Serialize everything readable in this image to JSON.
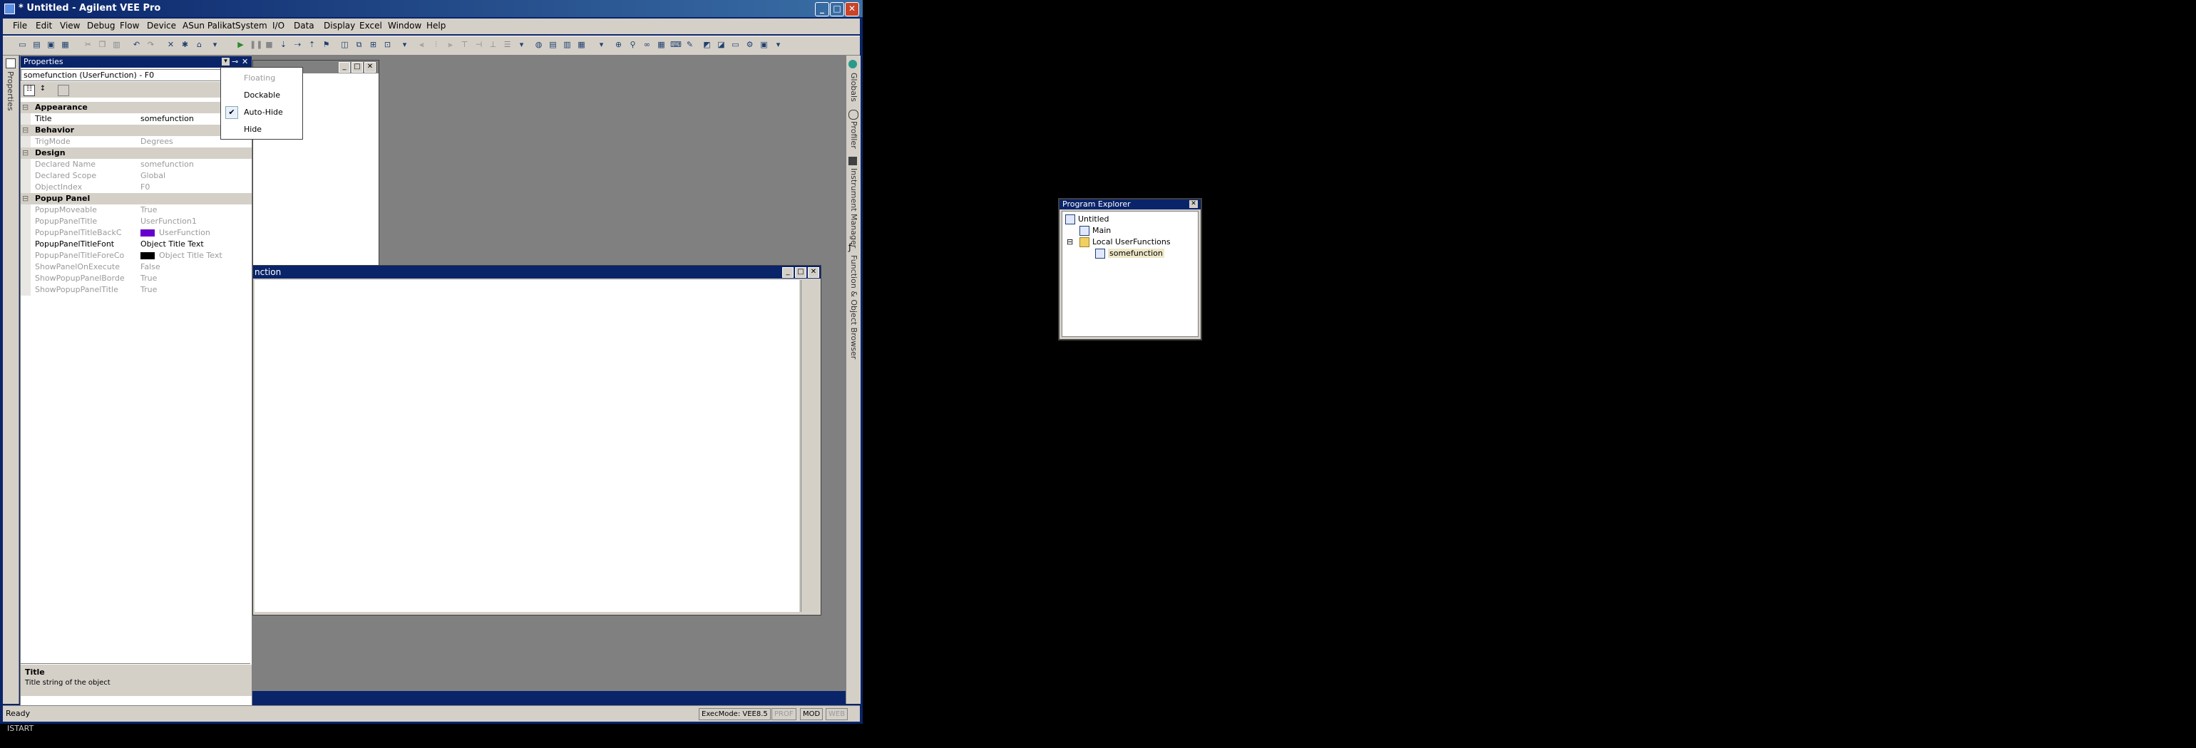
{
  "window": {
    "title": "* Untitled - Agilent VEE Pro",
    "min_glyph": "_",
    "max_glyph": "□",
    "close_glyph": "✕"
  },
  "menu": [
    "File",
    "Edit",
    "View",
    "Debug",
    "Flow",
    "Device",
    "ASun Palikat",
    "System",
    "I/O",
    "Data",
    "Display",
    "Excel",
    "Window",
    "Help"
  ],
  "left_dock": {
    "tab_label": "Properties"
  },
  "properties": {
    "panel_title": "Properties",
    "object_name": "somefunction (UserFunction) - F0",
    "categories": [
      {
        "name": "Appearance",
        "rows": [
          {
            "label": "Title",
            "value": "somefunction",
            "dim": false
          }
        ]
      },
      {
        "name": "Behavior",
        "rows": [
          {
            "label": "TrigMode",
            "value": "Degrees",
            "dim": true
          }
        ]
      },
      {
        "name": "Design",
        "rows": [
          {
            "label": "Declared Name",
            "value": "somefunction",
            "dim": true
          },
          {
            "label": "Declared Scope",
            "value": "Global",
            "dim": true
          },
          {
            "label": "ObjectIndex",
            "value": "F0",
            "dim": true
          }
        ]
      },
      {
        "name": "Popup Panel",
        "rows": [
          {
            "label": "PopupMoveable",
            "value": "True",
            "dim": true
          },
          {
            "label": "PopupPanelTitle",
            "value": "UserFunction1",
            "dim": true
          },
          {
            "label": "PopupPanelTitleBackC",
            "value": "UserFunction",
            "dim": true
          },
          {
            "label": "PopupPanelTitleFont",
            "value": "Object Title Text",
            "dim": false
          },
          {
            "label": "PopupPanelTitleForeCo",
            "value": "Object Title Text",
            "dim": true
          },
          {
            "label": "ShowPanelOnExecute",
            "value": "False",
            "dim": true
          },
          {
            "label": "ShowPopupPanelBorde",
            "value": "True",
            "dim": true
          },
          {
            "label": "ShowPopupPanelTitle",
            "value": "True",
            "dim": true
          }
        ]
      }
    ],
    "description_title": "Title",
    "description_text": "Title string of the object"
  },
  "dock_menu": {
    "items": [
      {
        "label": "Floating",
        "enabled": false,
        "checked": false
      },
      {
        "label": "Dockable",
        "enabled": true,
        "checked": false
      },
      {
        "label": "Auto-Hide",
        "enabled": true,
        "checked": true
      },
      {
        "label": "Hide",
        "enabled": true,
        "checked": false
      }
    ]
  },
  "function_window": {
    "title_fragment": "nction"
  },
  "right_dock": {
    "tabs": [
      "Globals",
      "Profiler",
      "Instrument Manager",
      "Function & Object Browser"
    ]
  },
  "explorer": {
    "title": "Program Explorer",
    "tree": [
      {
        "label": "Untitled",
        "level": 0
      },
      {
        "label": "Main",
        "level": 1
      },
      {
        "label": "Local UserFunctions",
        "level": 1,
        "expander": "⊟"
      },
      {
        "label": "somefunction",
        "level": 2,
        "selected": true
      }
    ]
  },
  "status": {
    "text": "Ready",
    "exec_mode": "ExecMode: VEE8.5",
    "prof": "PROF",
    "mod": "MOD",
    "web": "WEB"
  },
  "taskbar_fragment": "ISTART",
  "colors": {
    "titlebar": "#0a246a",
    "mdi_background": "#808080",
    "popup_backcolor_swatch": "#6600cc",
    "popup_forecolor_swatch": "#000000"
  }
}
